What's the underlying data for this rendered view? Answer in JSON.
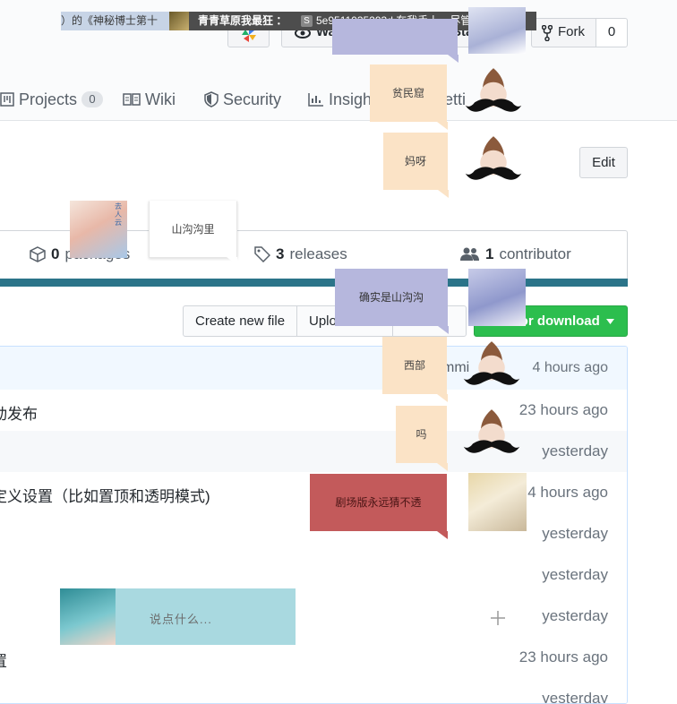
{
  "header": {
    "danmaku": {
      "left_text": "）的《神秘博士第十",
      "mid_text": "青青草原我最狂 ：",
      "id_badge": "S",
      "id_text": "5e9511035293d 在我手上，尽管来争夺吧"
    },
    "watch_label": "Wa",
    "star_label": "Sta",
    "fork_label": "Fork",
    "fork_count": "0"
  },
  "nav": {
    "tabs": [
      {
        "label": "Projects",
        "count": "0"
      },
      {
        "label": "Wiki"
      },
      {
        "label": "Security"
      },
      {
        "label": "Insigh"
      },
      {
        "label": "etti"
      }
    ]
  },
  "edit_label": "Edit",
  "summary": {
    "packages_count": "0",
    "packages_label": "packages",
    "releases_count": "3",
    "releases_label": "releases",
    "contributors_count": "1",
    "contributors_label": "contributor"
  },
  "file_actions": {
    "create_label": "Create new file",
    "upload_label": "Uplo",
    "clone_label": "or download"
  },
  "commit_bar": {
    "partial_label": "mmi",
    "time": "4 hours ago"
  },
  "files": [
    {
      "message": "动发布",
      "age": "23 hours ago"
    },
    {
      "message": "",
      "age": "yesterday"
    },
    {
      "message": "定义设置（比如置顶和透明模式)",
      "age": "4 hours ago"
    },
    {
      "message": "",
      "age": "yesterday"
    },
    {
      "message": "",
      "age": "yesterday"
    },
    {
      "message": "",
      "age": "yesterday"
    },
    {
      "message": "置",
      "age": "23 hours ago"
    },
    {
      "message": "",
      "age": "yesterday"
    }
  ],
  "chat": {
    "bubbles": [
      {
        "text": "贫民窟"
      },
      {
        "text": "妈呀"
      },
      {
        "text": "山沟沟里"
      },
      {
        "text": "确实是山沟沟"
      },
      {
        "text": "西部"
      },
      {
        "text": "吗"
      },
      {
        "text": "剧场版永远猜不透"
      }
    ],
    "avatar_caption": "去人云",
    "input_placeholder": "说点什么..."
  },
  "colors": {
    "accent_green": "#2cbe4e",
    "language_bar": "#2b7489",
    "bubble_peach": "#fbe3c6",
    "bubble_lavender": "#b6b7dd",
    "bubble_red": "#c35a5b",
    "chat_input_bg": "#a9d9e0"
  },
  "icons": {
    "fork": "fork-icon",
    "watch": "eye-icon",
    "projects": "project-icon",
    "wiki": "book-icon",
    "security": "shield-icon",
    "insights": "graph-icon",
    "packages": "package-icon",
    "releases": "tag-icon",
    "contributors": "people-icon",
    "caret": "caret-down-icon"
  }
}
